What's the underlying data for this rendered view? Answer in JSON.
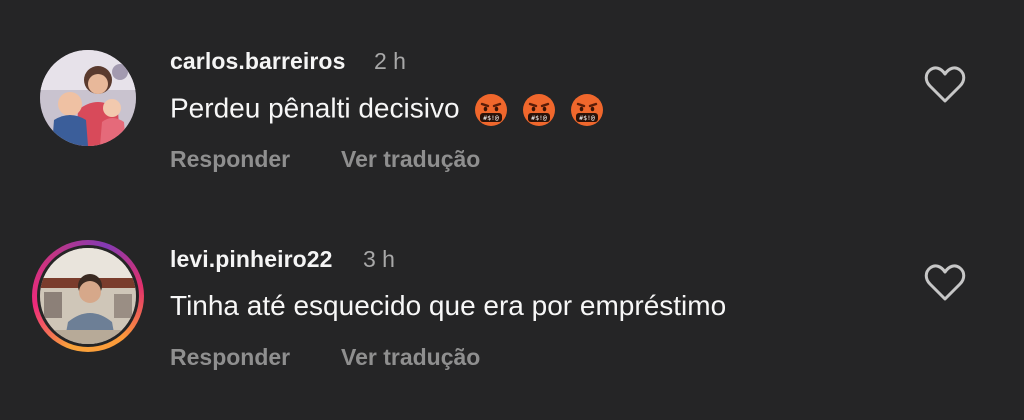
{
  "comments": [
    {
      "username": "carlos.barreiros",
      "time": "2 h",
      "text": "Perdeu pênalti decisivo",
      "emojis": [
        "face-with-symbols-on-mouth-icon",
        "face-with-symbols-on-mouth-icon",
        "face-with-symbols-on-mouth-icon"
      ],
      "reply_label": "Responder",
      "translate_label": "Ver tradução",
      "has_story_ring": false
    },
    {
      "username": "levi.pinheiro22",
      "time": "3 h",
      "text": "Tinha até esquecido que era por empréstimo",
      "emojis": [],
      "reply_label": "Responder",
      "translate_label": "Ver tradução",
      "has_story_ring": true
    }
  ],
  "colors": {
    "background": "#252526",
    "username": "#f5f5f5",
    "secondary": "#a8a8a8",
    "action": "#8f8f8f",
    "emoji_face": "#f0672c"
  }
}
